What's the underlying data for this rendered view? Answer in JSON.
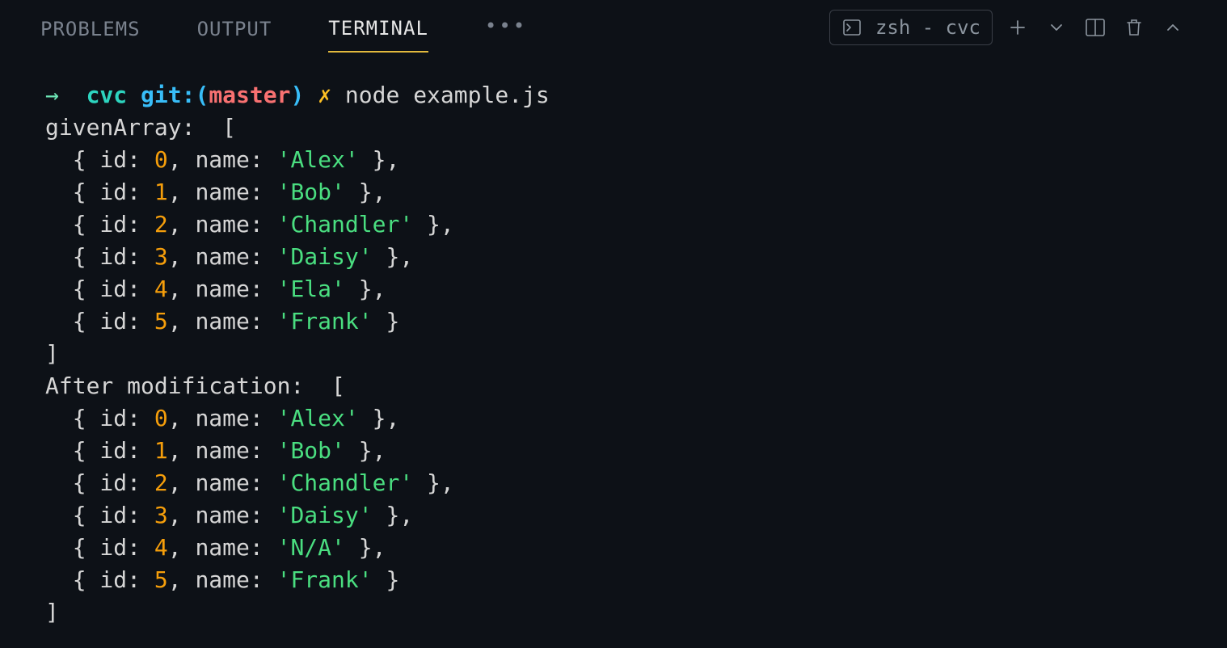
{
  "tabs": {
    "problems": "PROBLEMS",
    "output": "OUTPUT",
    "terminal": "TERMINAL"
  },
  "toolbar": {
    "shell_label": "zsh - cvc"
  },
  "prompt": {
    "arrow": "→",
    "cwd": "cvc",
    "git_label": "git:",
    "branch": "master",
    "dirty": "✗",
    "command": "node example.js"
  },
  "output": {
    "label1": "givenArray:",
    "label2": "After modification:",
    "array1": [
      {
        "id": 0,
        "name": "Alex"
      },
      {
        "id": 1,
        "name": "Bob"
      },
      {
        "id": 2,
        "name": "Chandler"
      },
      {
        "id": 3,
        "name": "Daisy"
      },
      {
        "id": 4,
        "name": "Ela"
      },
      {
        "id": 5,
        "name": "Frank"
      }
    ],
    "array2": [
      {
        "id": 0,
        "name": "Alex"
      },
      {
        "id": 1,
        "name": "Bob"
      },
      {
        "id": 2,
        "name": "Chandler"
      },
      {
        "id": 3,
        "name": "Daisy"
      },
      {
        "id": 4,
        "name": "N/A"
      },
      {
        "id": 5,
        "name": "Frank"
      }
    ]
  }
}
